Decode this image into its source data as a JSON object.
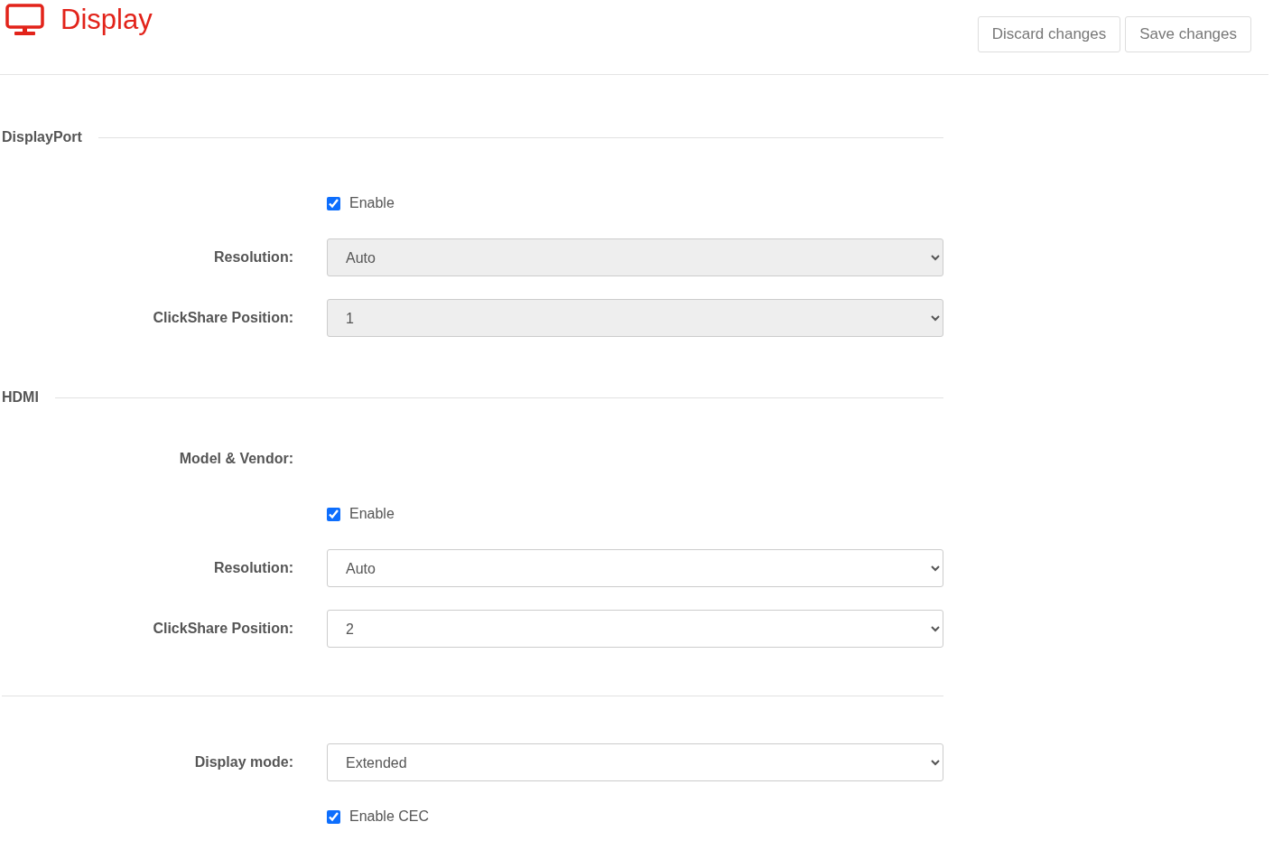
{
  "header": {
    "title": "Display",
    "buttons": [
      "Discard changes",
      "Save changes"
    ]
  },
  "sections": [
    {
      "title": "DisplayPort",
      "rows": [
        {
          "kind": "checkbox",
          "label": "Enable",
          "checked": true
        },
        {
          "kind": "select",
          "label": "Resolution:",
          "value": "Auto",
          "disabled": true
        },
        {
          "kind": "select",
          "label": "ClickShare Position:",
          "value": "1",
          "disabled": true
        }
      ]
    },
    {
      "title": "HDMI",
      "rows": [
        {
          "kind": "info",
          "label": "Model & Vendor:"
        },
        {
          "kind": "checkbox",
          "label": "Enable",
          "checked": true
        },
        {
          "kind": "select",
          "label": "Resolution:",
          "value": "Auto",
          "disabled": false
        },
        {
          "kind": "select",
          "label": "ClickShare Position:",
          "value": "2",
          "disabled": false
        }
      ]
    },
    {
      "rows": [
        {
          "kind": "select",
          "label": "Display mode:",
          "value": "Extended",
          "disabled": false
        },
        {
          "kind": "checkbox",
          "label": "Enable CEC",
          "checked": true
        }
      ]
    }
  ]
}
